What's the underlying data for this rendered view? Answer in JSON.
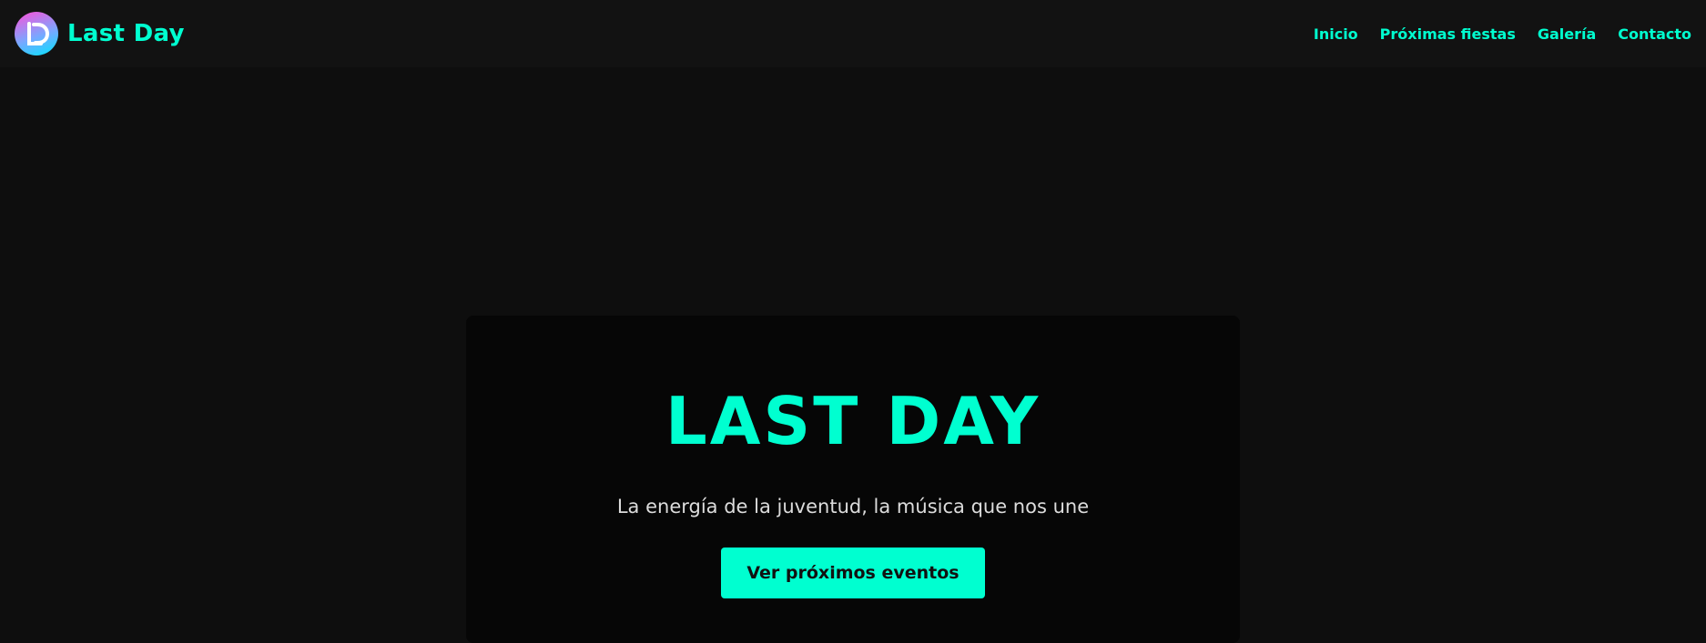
{
  "header": {
    "brand_name": "Last Day",
    "nav": [
      {
        "label": "Inicio"
      },
      {
        "label": "Próximas fiestas"
      },
      {
        "label": "Galería"
      },
      {
        "label": "Contacto"
      }
    ]
  },
  "hero": {
    "title": "LAST DAY",
    "subtitle": "La energía de la juventud, la música que nos une",
    "cta_label": "Ver próximos eventos"
  },
  "colors": {
    "accent": "#00ffd0",
    "background": "#0e0e0e",
    "navbar_bg": "#121212",
    "card_bg": "#060606"
  },
  "icons": {
    "logo": "ld-logo-icon"
  }
}
